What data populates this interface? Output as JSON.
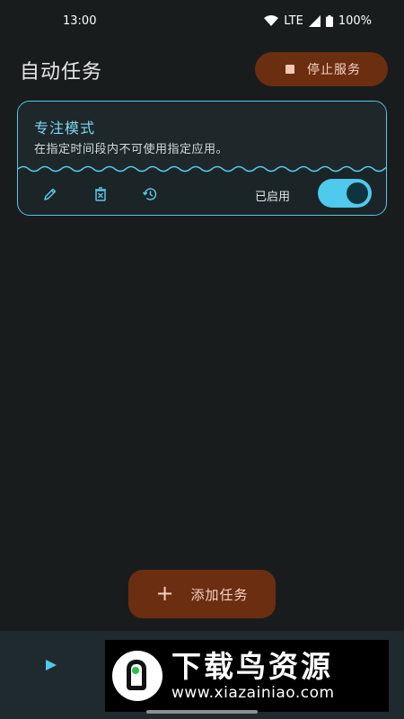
{
  "status_bar": {
    "time": "13:00",
    "network": "LTE",
    "battery": "100%"
  },
  "header": {
    "title": "自动任务",
    "stop_service_label": "停止服务"
  },
  "task": {
    "title": "专注模式",
    "description": "在指定时间段内不可使用指定应用。",
    "enabled_label": "已启用",
    "enabled": true,
    "icons": [
      "edit-icon",
      "delete-icon",
      "history-icon"
    ]
  },
  "fab": {
    "add_task_label": "添加任务"
  },
  "watermark": {
    "title": "下载鸟资源",
    "url": "www.xiazainiao.com"
  },
  "colors": {
    "background": "#191c1d",
    "accent": "#58c8e6",
    "button_bg": "#6b2e10",
    "button_text": "#f3d2c2",
    "toggle_on": "#4fc9ec"
  }
}
